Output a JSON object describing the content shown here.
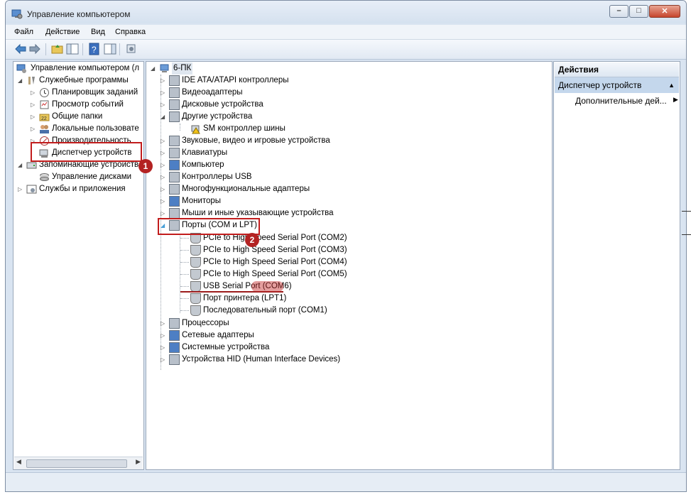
{
  "window": {
    "title": "Управление компьютером",
    "close_glyph": "✕",
    "min_glyph": "–",
    "max_glyph": "□"
  },
  "menu": [
    "Файл",
    "Действие",
    "Вид",
    "Справка"
  ],
  "toolbar_icons": [
    "back-arrow-icon",
    "forward-arrow-icon",
    "folder-up-icon",
    "console-tree-icon",
    "help-icon",
    "show-hide-icon",
    "properties-icon"
  ],
  "left_tree": {
    "root": "Управление компьютером (л",
    "services": "Служебные программы",
    "items": [
      "Планировщик заданий",
      "Просмотр событий",
      "Общие папки",
      "Локальные пользовате",
      "Производительность",
      "Диспетчер устройств"
    ],
    "storage": "Запоминающие устройств",
    "disks": "Управление дисками",
    "services_apps": "Службы и приложения"
  },
  "device_tree": {
    "root": "6-ПК",
    "categories": [
      "IDE ATA/ATAPI контроллеры",
      "Видеоадаптеры",
      "Дисковые устройства",
      "Другие устройства",
      "Звуковые, видео и игровые устройства",
      "Клавиатуры",
      "Компьютер",
      "Контроллеры USB",
      "Многофункциональные адаптеры",
      "Мониторы",
      "Мыши и иные указывающие устройства",
      "Порты (COM и LPT)",
      "Процессоры",
      "Сетевые адаптеры",
      "Системные устройства",
      "Устройства HID (Human Interface Devices)"
    ],
    "other_child": "SM контроллер шины",
    "ports": [
      "PCIe to High Speed Serial Port (COM2)",
      "PCIe to High Speed Serial Port (COM3)",
      "PCIe to High Speed Serial Port (COM4)",
      "PCIe to High Speed Serial Port (COM5)",
      "USB Serial Port (COM6)",
      "Порт принтера (LPT1)",
      "Последовательный порт (COM1)"
    ]
  },
  "actions": {
    "header": "Действия",
    "selected": "Диспетчер устройств",
    "more": "Дополнительные дей..."
  },
  "annotations": {
    "badge1": "1",
    "badge2": "2"
  },
  "colors": {
    "accent_red": "#c21d1d",
    "frame": "#d9e4f1",
    "selection": "#c4d7ec"
  }
}
